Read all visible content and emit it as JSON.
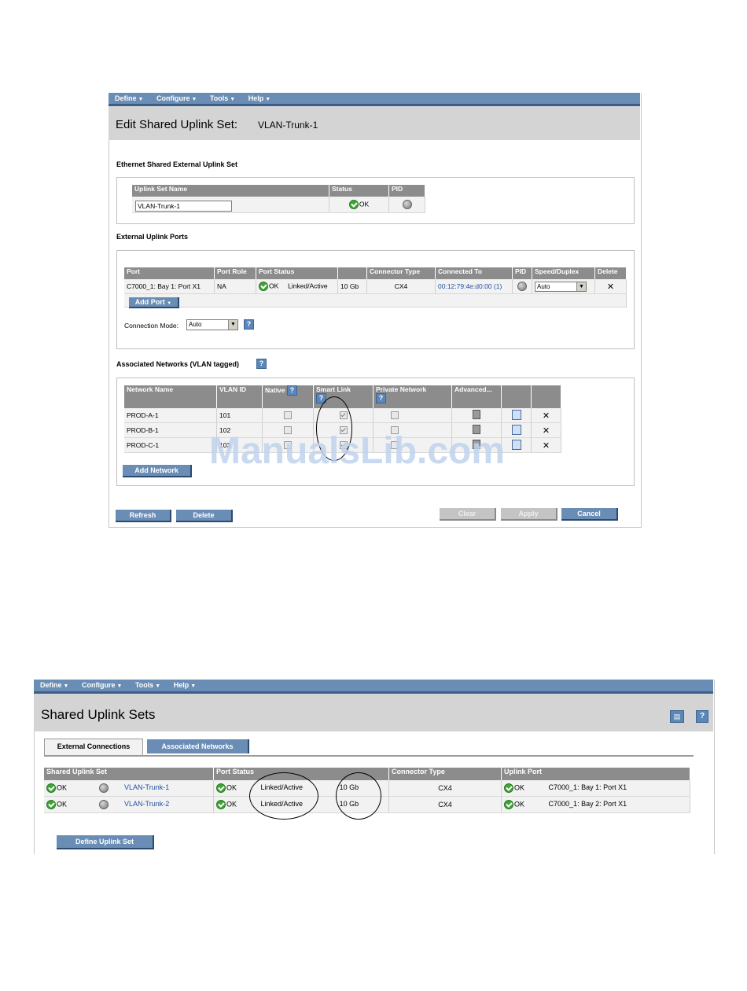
{
  "top": {
    "menu": [
      "Define",
      "Configure",
      "Tools",
      "Help"
    ],
    "title": "Edit Shared Uplink Set:",
    "title_value": "VLAN-Trunk-1",
    "eth_section": "Ethernet Shared External Uplink Set",
    "uplink_headers": [
      "Uplink Set Name",
      "Status",
      "PID"
    ],
    "uplink_name_value": "VLAN-Trunk-1",
    "uplink_status": "OK",
    "ports_section": "External Uplink Ports",
    "port_headers": [
      "Port",
      "Port Role",
      "Port Status",
      "",
      "Connector Type",
      "Connected To",
      "PID",
      "Speed/Duplex",
      "Delete"
    ],
    "port_row": {
      "port": "C7000_1: Bay 1: Port X1",
      "role": "NA",
      "status_ok": "OK",
      "link": "Linked/Active",
      "speed": "10 Gb",
      "connector": "CX4",
      "connected_to": "00:12:79:4e:d0:00 (1)",
      "speed_duplex": "Auto",
      "delete": "✕"
    },
    "add_port": "Add Port",
    "connection_mode_label": "Connection Mode:",
    "connection_mode_value": "Auto",
    "assoc_section": "Associated Networks (VLAN tagged)",
    "net_headers": [
      "Network Name",
      "VLAN ID",
      "Native",
      "Smart Link",
      "Private Network",
      "Advanced..."
    ],
    "networks": [
      {
        "name": "PROD-A-1",
        "vlan": "101"
      },
      {
        "name": "PROD-B-1",
        "vlan": "102"
      },
      {
        "name": "PROD-C-1",
        "vlan": "103"
      }
    ],
    "add_network": "Add Network",
    "buttons": {
      "refresh": "Refresh",
      "delete": "Delete",
      "clear": "Clear",
      "apply": "Apply",
      "cancel": "Cancel"
    },
    "watermark": "ManualsLib.com"
  },
  "bottom": {
    "menu": [
      "Define",
      "Configure",
      "Tools",
      "Help"
    ],
    "title": "Shared Uplink Sets",
    "tabs": [
      "External Connections",
      "Associated Networks"
    ],
    "headers": [
      "Shared Uplink Set",
      "Port Status",
      "Connector Type",
      "Uplink Port"
    ],
    "rows": [
      {
        "status": "OK",
        "name": "VLAN-Trunk-1",
        "port_ok": "OK",
        "link": "Linked/Active",
        "speed": "10 Gb",
        "connector": "CX4",
        "uplink_ok": "OK",
        "uplink_port": "C7000_1: Bay 1: Port X1"
      },
      {
        "status": "OK",
        "name": "VLAN-Trunk-2",
        "port_ok": "OK",
        "link": "Linked/Active",
        "speed": "10 Gb",
        "connector": "CX4",
        "uplink_ok": "OK",
        "uplink_port": "C7000_1: Bay 2: Port X1"
      }
    ],
    "define_button": "Define Uplink Set"
  }
}
